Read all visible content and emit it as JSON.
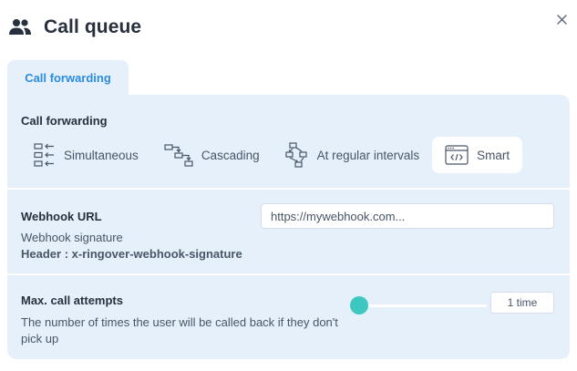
{
  "header": {
    "title": "Call queue",
    "icon": "people-icon"
  },
  "close": {
    "icon": "close-icon"
  },
  "tabs": [
    {
      "label": "Call forwarding",
      "active": true
    }
  ],
  "forwarding": {
    "title": "Call forwarding",
    "options": [
      {
        "label": "Simultaneous",
        "icon": "simultaneous-icon",
        "selected": false
      },
      {
        "label": "Cascading",
        "icon": "cascading-icon",
        "selected": false
      },
      {
        "label": "At regular intervals",
        "icon": "regular-intervals-icon",
        "selected": false
      },
      {
        "label": "Smart",
        "icon": "code-window-icon",
        "selected": true
      }
    ]
  },
  "webhook": {
    "title": "Webhook URL",
    "signature_label": "Webhook signature",
    "header_label": "Header : x-ringover-webhook-signature",
    "url_value": "",
    "url_placeholder": "https://mywebhook.com..."
  },
  "max_attempts": {
    "title": "Max. call attempts",
    "description": "The number of times the user will be called back if they don't pick up",
    "slider_fraction": 0,
    "value_label": "1 time"
  },
  "colors": {
    "accent": "#2c8ce0",
    "panel": "#e5f0fb",
    "slider": "#3ec6c0",
    "text": "#27303d"
  }
}
